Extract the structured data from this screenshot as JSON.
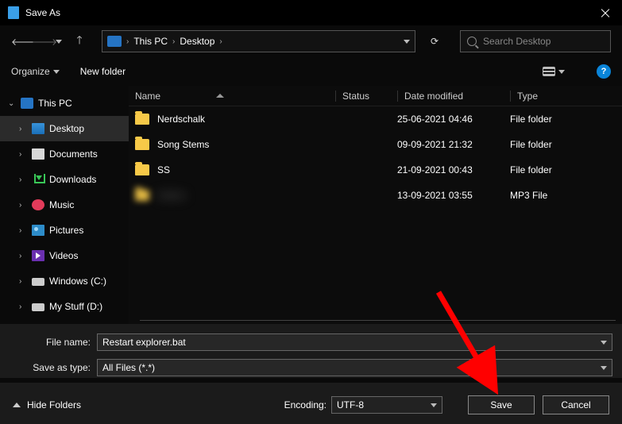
{
  "window": {
    "title": "Save As"
  },
  "address": {
    "crumb1": "This PC",
    "crumb2": "Desktop"
  },
  "search": {
    "placeholder": "Search Desktop"
  },
  "toolbar": {
    "organize": "Organize",
    "new_folder": "New folder"
  },
  "sidebar": {
    "this_pc": "This PC",
    "items": [
      {
        "label": "Desktop"
      },
      {
        "label": "Documents"
      },
      {
        "label": "Downloads"
      },
      {
        "label": "Music"
      },
      {
        "label": "Pictures"
      },
      {
        "label": "Videos"
      },
      {
        "label": "Windows (C:)"
      },
      {
        "label": "My Stuff (D:)"
      }
    ]
  },
  "columns": {
    "name": "Name",
    "status": "Status",
    "date": "Date modified",
    "type": "Type"
  },
  "rows": [
    {
      "name": "Nerdschalk",
      "date": "25-06-2021 04:46",
      "type": "File folder"
    },
    {
      "name": "Song Stems",
      "date": "09-09-2021 21:32",
      "type": "File folder"
    },
    {
      "name": "SS",
      "date": "21-09-2021 00:43",
      "type": "File folder"
    },
    {
      "name": "hidden",
      "date": "13-09-2021 03:55",
      "type": "MP3 File"
    }
  ],
  "form": {
    "file_name_label": "File name:",
    "file_name_value": "Restart explorer.bat",
    "save_type_label": "Save as type:",
    "save_type_value": "All Files  (*.*)"
  },
  "footer": {
    "hide_folders": "Hide Folders",
    "encoding_label": "Encoding:",
    "encoding_value": "UTF-8",
    "save": "Save",
    "cancel": "Cancel"
  },
  "annotation": {
    "arrow_color": "#ff0000"
  }
}
